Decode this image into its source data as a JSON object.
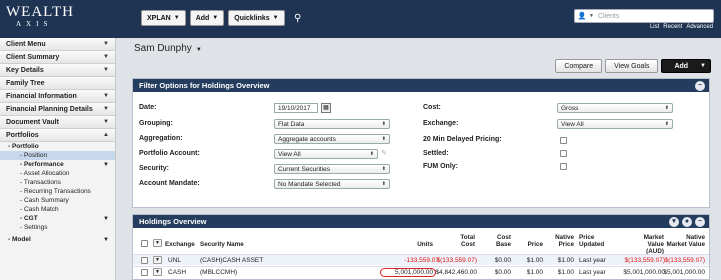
{
  "brand": {
    "line1": "WEALTH",
    "line2": "AXIS"
  },
  "topnav": [
    {
      "label": "XPLAN"
    },
    {
      "label": "Add"
    },
    {
      "label": "Quicklinks"
    }
  ],
  "search": {
    "placeholder": "Clients"
  },
  "toplinks": [
    "List",
    "Recent",
    "Advanced"
  ],
  "sidebar": {
    "sections_top": [
      "Client Menu",
      "Client Summary",
      "Key Details",
      "Family Tree",
      "Financial Information",
      "Financial Planning Details",
      "Document Vault",
      "Portfolios"
    ],
    "portfolio": "- Portfolio",
    "items": [
      {
        "label": "- Position",
        "active": true
      },
      {
        "label": "- Performance",
        "bold": true,
        "arrow": true
      },
      {
        "label": "- Asset Allocation"
      },
      {
        "label": "- Transactions"
      },
      {
        "label": "- Recurring Transactions"
      },
      {
        "label": "- Cash Summary"
      },
      {
        "label": "- Cash Match"
      },
      {
        "label": "- CGT",
        "bold": true,
        "arrow": true
      },
      {
        "label": "- Settings"
      }
    ],
    "model": "- Model"
  },
  "client": {
    "name": "Sam Dunphy"
  },
  "actions": {
    "compare": "Compare",
    "view_goals": "View Goals",
    "add": "Add"
  },
  "filter": {
    "title": "Filter Options for Holdings Overview",
    "date_label": "Date:",
    "date_value": "19/10/2017",
    "grouping_label": "Grouping:",
    "grouping_value": "Flat Data",
    "aggregation_label": "Aggregation:",
    "aggregation_value": "Aggregate accounts",
    "portfolio_account_label": "Portfolio Account:",
    "portfolio_account_value": "View All",
    "security_label": "Security:",
    "security_value": "Current Securities",
    "account_mandate_label": "Account Mandate:",
    "account_mandate_value": "No Mandate Selected",
    "cost_label": "Cost:",
    "cost_value": "Gross",
    "exchange_label": "Exchange:",
    "exchange_value": "View All",
    "delayed_label": "20 Min Delayed Pricing:",
    "settled_label": "Settled:",
    "fum_label": "FUM Only:"
  },
  "holdings": {
    "title": "Holdings Overview",
    "headers": {
      "exchange": "Exchange",
      "security_name": "Security Name",
      "units": "Units",
      "total_cost_1": "Total",
      "total_cost_2": "Cost",
      "cost_base_1": "Cost",
      "cost_base_2": "Base",
      "price": "Price",
      "native_price_1": "Native",
      "native_price_2": "Price",
      "price_updated_1": "Price",
      "price_updated_2": "Updated",
      "market_value_aud_1": "Market",
      "market_value_aud_2": "Value (AUD)",
      "native_market_value_1": "Native",
      "native_market_value_2": "Market Value"
    },
    "rows": [
      {
        "exchange": "UNL",
        "security_name": "(CASH)CASH ASSET",
        "units": "-133,559.07",
        "total_cost": "$(133,559.07)",
        "cost_base": "$0.00",
        "price": "$1.00",
        "native_price": "$1.00",
        "price_updated": "Last year",
        "market_value_aud": "$(133,559.07)",
        "native_market_value": "$(133,559.07)"
      },
      {
        "exchange": "CASH",
        "security_name": "(MBLCCMH)",
        "units": "5,001,000.00",
        "total_cost": "$4,842,460.00",
        "cost_base": "$0.00",
        "price": "$1.00",
        "native_price": "$1.00",
        "price_updated": "Last year",
        "market_value_aud": "$5,001,000.00",
        "native_market_value": "$5,001,000.00"
      }
    ]
  },
  "colors": {
    "header_bg": "#1f3453",
    "panel_header": "#243c5e",
    "negative": "#dd1111",
    "active_nav": "#c8d8ec"
  }
}
